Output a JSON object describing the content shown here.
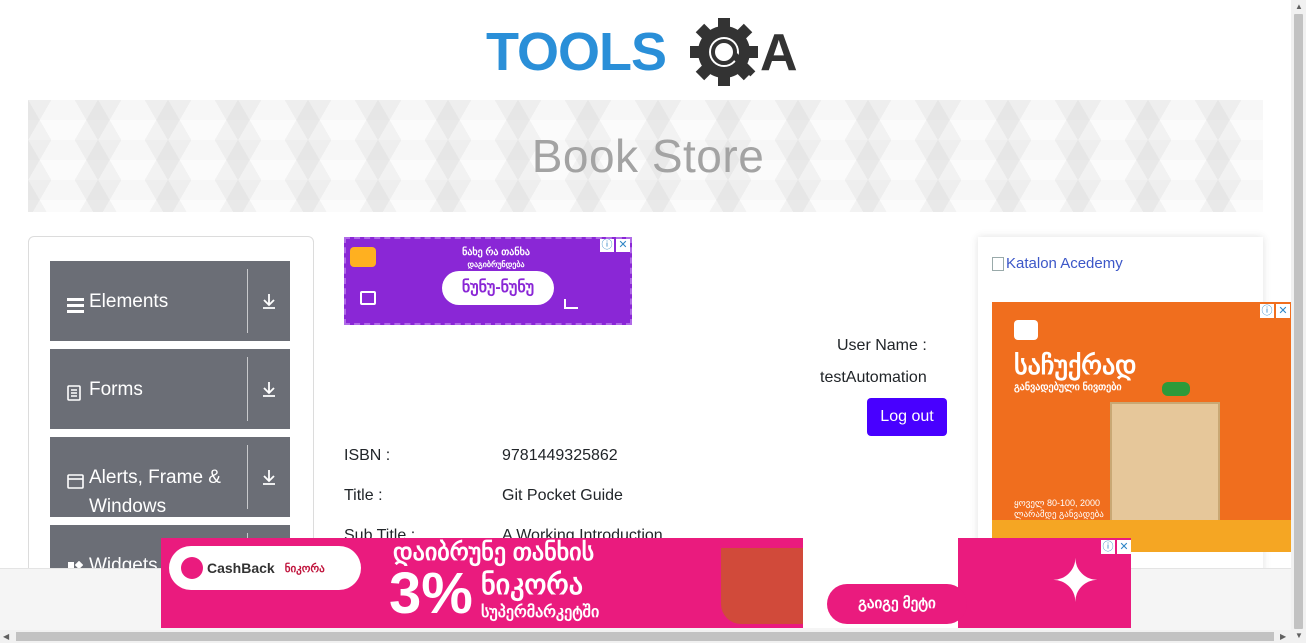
{
  "logo": {
    "text_tools": "TOOLS",
    "text_a": "A"
  },
  "banner": {
    "title": "Book Store"
  },
  "sidebar": {
    "groups": [
      {
        "label": "Elements",
        "icon": "hamburger-icon"
      },
      {
        "label": "Forms",
        "icon": "document-icon"
      },
      {
        "label": "Alerts, Frame & Windows",
        "icon": "window-icon"
      },
      {
        "label": "Widgets",
        "icon": "widgets-icon"
      }
    ]
  },
  "user": {
    "username_label": "User Name :",
    "username_value": "testAutomation",
    "logout_label": "Log out"
  },
  "book": {
    "isbn_label": "ISBN :",
    "isbn_value": "9781449325862",
    "title_label": "Title :",
    "title_value": "Git Pocket Guide",
    "subtitle_label": "Sub Title :",
    "subtitle_value": "A Working Introduction"
  },
  "ads": {
    "top_line1": "ნახე რა თანხა",
    "top_line2": "დაგიბრუნდება",
    "top_brand": "ნუნუ-ნუნუ",
    "katalon_alt": "Katalon Acedemy",
    "right_title": "საჩუქრად",
    "right_subtitle": "განვადებული ნივთები",
    "right_note": "ყოველ 80-100, 2000 ლარამდე განვადება",
    "bottom_brand": "CashBack",
    "bottom_brand2": "ნიკორა",
    "bottom_line1": "დაიბრუნე თანხის",
    "bottom_percent": "3%",
    "bottom_line2": "ნიკორა",
    "bottom_line3": "სუპერმარკეტში",
    "bottom_cta": "გაიგე მეტი",
    "close_glyph": "✕",
    "info_glyph": "ⓘ"
  },
  "colors": {
    "logo_blue": "#2a8fd8",
    "logo_dark": "#333333",
    "sidebar_group": "#6b6e76",
    "logout_button": "#4800ff",
    "ad_purple": "#8a27d6",
    "ad_orange": "#f06e1e",
    "ad_pink": "#ea1b7e"
  }
}
